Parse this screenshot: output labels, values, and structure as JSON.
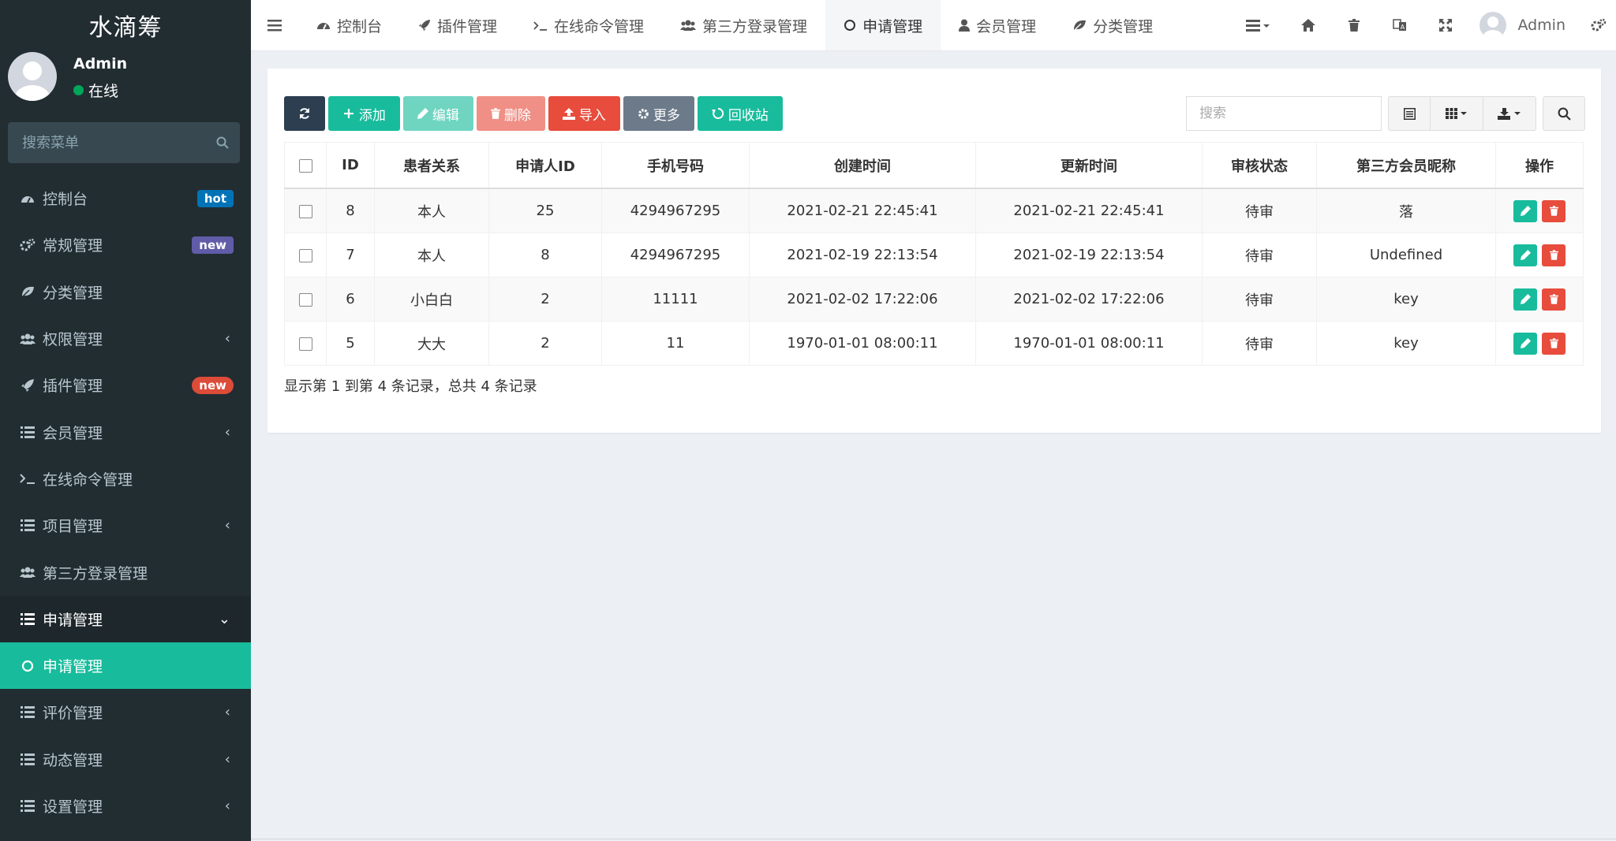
{
  "brand": "水滴筹",
  "user": {
    "name": "Admin",
    "status": "在线"
  },
  "sidebar_search": {
    "placeholder": "搜索菜单"
  },
  "sidebar": {
    "items": [
      {
        "label": "控制台",
        "badge": "hot",
        "badge_color": "#0073b7"
      },
      {
        "label": "常规管理",
        "badge": "new",
        "badge_color": "#605ca8"
      },
      {
        "label": "分类管理"
      },
      {
        "label": "权限管理",
        "chevron": "‹"
      },
      {
        "label": "插件管理",
        "badge": "new",
        "badge_color": "#dd4b39"
      },
      {
        "label": "会员管理",
        "chevron": "‹"
      },
      {
        "label": "在线命令管理"
      },
      {
        "label": "项目管理",
        "chevron": "‹"
      },
      {
        "label": "第三方登录管理"
      },
      {
        "label": "申请管理",
        "chevron": "⌄"
      },
      {
        "label": "申请管理"
      },
      {
        "label": "评价管理",
        "chevron": "‹"
      },
      {
        "label": "动态管理",
        "chevron": "‹"
      },
      {
        "label": "设置管理",
        "chevron": "‹"
      }
    ]
  },
  "navbar": {
    "tabs": [
      {
        "label": "控制台"
      },
      {
        "label": "插件管理"
      },
      {
        "label": "在线命令管理"
      },
      {
        "label": "第三方登录管理"
      },
      {
        "label": "申请管理"
      },
      {
        "label": "会员管理"
      },
      {
        "label": "分类管理"
      }
    ],
    "user_name": "Admin"
  },
  "toolbar": {
    "add": "添加",
    "edit": "编辑",
    "delete": "删除",
    "import": "导入",
    "more": "更多",
    "recycle": "回收站"
  },
  "search": {
    "placeholder": "搜索"
  },
  "table": {
    "columns": [
      "ID",
      "患者关系",
      "申请人ID",
      "手机号码",
      "创建时间",
      "更新时间",
      "审核状态",
      "第三方会员昵称",
      "操作"
    ],
    "rows": [
      {
        "id": "8",
        "relation": "本人",
        "applicant_id": "25",
        "phone": "4294967295",
        "created": "2021-02-21 22:45:41",
        "updated": "2021-02-21 22:45:41",
        "status": "待审",
        "nickname": "落"
      },
      {
        "id": "7",
        "relation": "本人",
        "applicant_id": "8",
        "phone": "4294967295",
        "created": "2021-02-19 22:13:54",
        "updated": "2021-02-19 22:13:54",
        "status": "待审",
        "nickname": "Undefined"
      },
      {
        "id": "6",
        "relation": "小白白",
        "applicant_id": "2",
        "phone": "11111",
        "created": "2021-02-02 17:22:06",
        "updated": "2021-02-02 17:22:06",
        "status": "待审",
        "nickname": "key"
      },
      {
        "id": "5",
        "relation": "大大",
        "applicant_id": "2",
        "phone": "11",
        "created": "1970-01-01 08:00:11",
        "updated": "1970-01-01 08:00:11",
        "status": "待审",
        "nickname": "key"
      }
    ]
  },
  "page_info": "显示第 1 到第 4 条记录，总共 4 条记录",
  "colors": {
    "accent": "#18bc9c",
    "sidebar": "#222d32",
    "danger": "#e74c3c",
    "dark": "#2c3e50"
  }
}
